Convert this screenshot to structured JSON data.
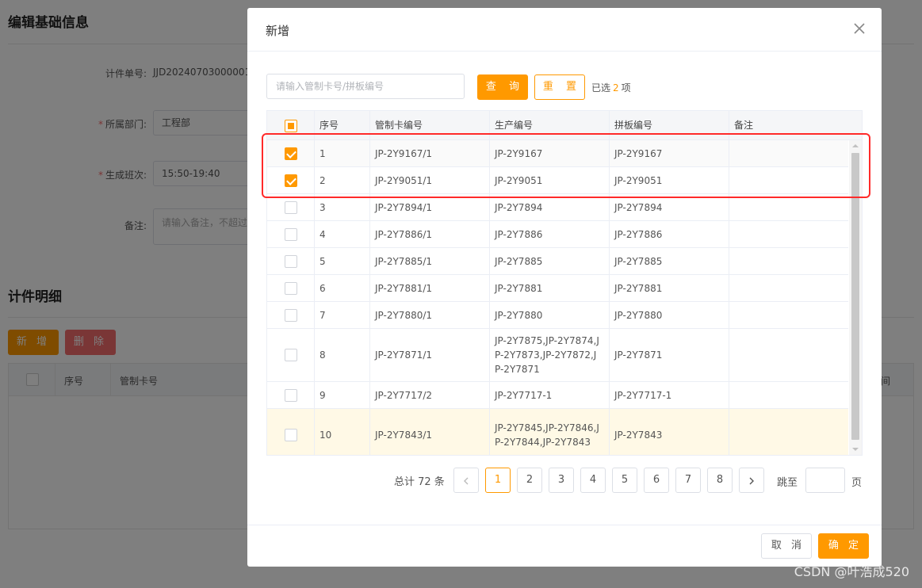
{
  "background": {
    "section1_title": "编辑基础信息",
    "fields": [
      {
        "label": "计件单号:",
        "required": false,
        "value": "JJD20240703000001"
      },
      {
        "label": "所属部门:",
        "required": true,
        "value": "工程部"
      },
      {
        "label": "生成班次:",
        "required": true,
        "value": "15:50-19:40"
      },
      {
        "label": "备注:",
        "required": false,
        "placeholder": "请输入备注，不超过"
      }
    ],
    "section2_title": "计件明细",
    "add_button": "新 增",
    "delete_button": "删 除",
    "table_columns": [
      "序号",
      "管制卡号",
      "间"
    ]
  },
  "dialog": {
    "title": "新增",
    "search_placeholder": "请输入管制卡号/拼板编号",
    "query_button": "查 询",
    "reset_button": "重 置",
    "selected_prefix": "已选",
    "selected_count": "2",
    "selected_suffix": "项",
    "columns": [
      "序号",
      "管制卡编号",
      "生产编号",
      "拼板编号",
      "备注"
    ],
    "rows": [
      {
        "no": "1",
        "card": "JP-2Y9167/1",
        "prod": "JP-2Y9167",
        "panel": "JP-2Y9167",
        "remark": "",
        "checked": true
      },
      {
        "no": "2",
        "card": "JP-2Y9051/1",
        "prod": "JP-2Y9051",
        "panel": "JP-2Y9051",
        "remark": "",
        "checked": true
      },
      {
        "no": "3",
        "card": "JP-2Y7894/1",
        "prod": "JP-2Y7894",
        "panel": "JP-2Y7894",
        "remark": "",
        "checked": false
      },
      {
        "no": "4",
        "card": "JP-2Y7886/1",
        "prod": "JP-2Y7886",
        "panel": "JP-2Y7886",
        "remark": "",
        "checked": false
      },
      {
        "no": "5",
        "card": "JP-2Y7885/1",
        "prod": "JP-2Y7885",
        "panel": "JP-2Y7885",
        "remark": "",
        "checked": false
      },
      {
        "no": "6",
        "card": "JP-2Y7881/1",
        "prod": "JP-2Y7881",
        "panel": "JP-2Y7881",
        "remark": "",
        "checked": false
      },
      {
        "no": "7",
        "card": "JP-2Y7880/1",
        "prod": "JP-2Y7880",
        "panel": "JP-2Y7880",
        "remark": "",
        "checked": false
      },
      {
        "no": "8",
        "card": "JP-2Y7871/1",
        "prod": "JP-2Y7875,JP-2Y7874,JP-2Y7873,JP-2Y7872,JP-2Y7871",
        "panel": "JP-2Y7871",
        "remark": "",
        "checked": false
      },
      {
        "no": "9",
        "card": "JP-2Y7717/2",
        "prod": "JP-2Y7717-1",
        "panel": "JP-2Y7717-1",
        "remark": "",
        "checked": false
      },
      {
        "no": "10",
        "card": "JP-2Y7843/1",
        "prod": "JP-2Y7845,JP-2Y7846,JP-2Y7844,JP-2Y7843",
        "panel": "JP-2Y7843",
        "remark": "",
        "checked": false
      }
    ],
    "pagination": {
      "total_text": "总计 72 条",
      "pages": [
        "1",
        "2",
        "3",
        "4",
        "5",
        "6",
        "7",
        "8"
      ],
      "current": "1",
      "jump_label": "跳至",
      "jump_suffix": "页"
    },
    "cancel_button": "取 消",
    "ok_button": "确 定"
  },
  "watermark": "CSDN @叶浩成520",
  "colors": {
    "accent": "#ff9900",
    "highlight_box": "#ff2a2a"
  }
}
